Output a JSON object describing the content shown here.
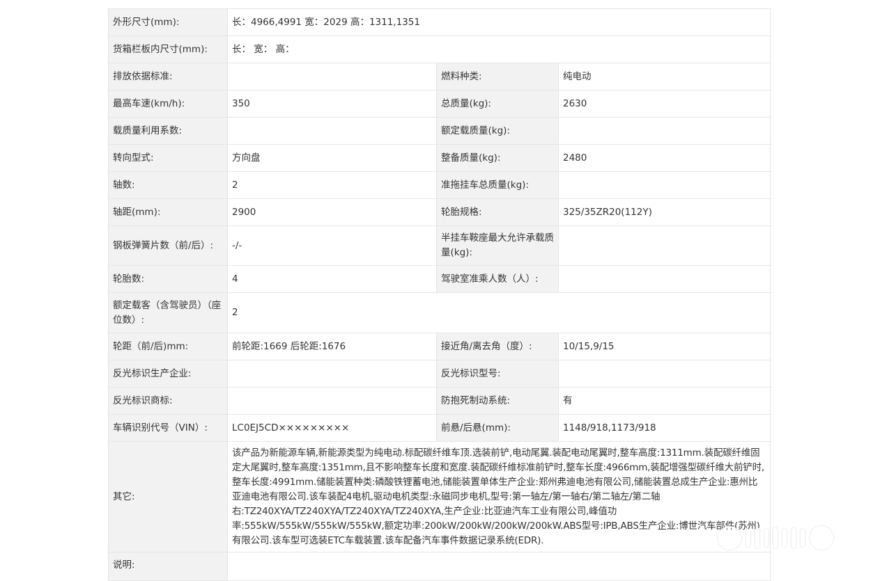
{
  "rows": [
    {
      "l1": "外形尺寸(mm):",
      "v1": "长：4966,4991 宽：2029 高：1311,1351"
    },
    {
      "l1": "货箱栏板内尺寸(mm):",
      "v1": "长： 宽： 高："
    },
    {
      "l1": "排放依据标准:",
      "v1": "",
      "l2": "燃料种类:",
      "v2": "纯电动"
    },
    {
      "l1": "最高车速(km/h):",
      "v1": "350",
      "l2": "总质量(kg):",
      "v2": "2630"
    },
    {
      "l1": "载质量利用系数:",
      "v1": "",
      "l2": "额定载质量(kg):",
      "v2": ""
    },
    {
      "l1": "转向型式:",
      "v1": "方向盘",
      "l2": "整备质量(kg):",
      "v2": "2480"
    },
    {
      "l1": "轴数:",
      "v1": "2",
      "l2": "准拖挂车总质量(kg):",
      "v2": ""
    },
    {
      "l1": "轴距(mm):",
      "v1": "2900",
      "l2": "轮胎规格:",
      "v2": "325/35ZR20(112Y)"
    },
    {
      "l1": "钢板弹簧片数（前/后）:",
      "v1": "-/-",
      "l2": "半挂车鞍座最大允许承载质量(kg):",
      "v2": ""
    },
    {
      "l1": "轮胎数:",
      "v1": "4",
      "l2": "驾驶室准乘人数（人）:",
      "v2": ""
    },
    {
      "l1": "额定载客（含驾驶员）（座位数）:",
      "v1": "2"
    },
    {
      "l1": "轮距（前/后)mm:",
      "v1": "前轮距:1669 后轮距:1676",
      "l2": "接近角/离去角（度）:",
      "v2": "10/15,9/15"
    },
    {
      "l1": "反光标识生产企业:",
      "v1": "",
      "l2": "反光标识型号:",
      "v2": ""
    },
    {
      "l1": "反光标识商标:",
      "v1": "",
      "l2": "防抱死制动系统:",
      "v2": "有"
    },
    {
      "l1": "车辆识别代号（VIN）:",
      "v1": "LC0EJ5CD×××××××××",
      "l2": "前悬/后悬(mm):",
      "v2": "1148/918,1173/918"
    }
  ],
  "other": {
    "label": "其它:",
    "text": "该产品为新能源车辆,新能源类型为纯电动.标配碳纤维车顶.选装前铲,电动尾翼.装配电动尾翼时,整车高度:1311mm.装配碳纤维固定大尾翼时,整车高度:1351mm,且不影响整车长度和宽度.装配碳纤维标准前铲时,整车长度:4966mm,装配增强型碳纤维大前铲时,整车长度:4991mm.储能装置种类:磷酸铁锂蓄电池,储能装置单体生产企业:郑州弗迪电池有限公司,储能装置总成生产企业:惠州比亚迪电池有限公司.该车装配4电机,驱动电机类型:永磁同步电机,型号:第一轴左/第一轴右/第二轴左/第二轴右:TZ240XYA/TZ240XYA/TZ240XYA/TZ240XYA,生产企业:比亚迪汽车工业有限公司,峰值功率:555kW/555kW/555kW/555kW,额定功率:200kW/200kW/200kW/200kW.ABS型号:IPB,ABS生产企业:博世汽车部件(苏州)有限公司.该车型可选装ETC车载装置.该车配备汽车事件数据记录系统(EDR)."
  },
  "note": {
    "label": "说明:",
    "text": ""
  }
}
